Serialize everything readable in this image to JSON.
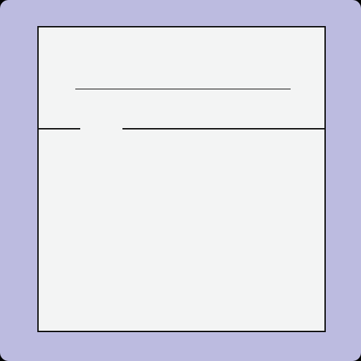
{
  "colors": {
    "frame_background": "#bcbbe0",
    "card_background": "#f3f4f4",
    "outline": "#111111",
    "corner_dots": "#000000"
  }
}
